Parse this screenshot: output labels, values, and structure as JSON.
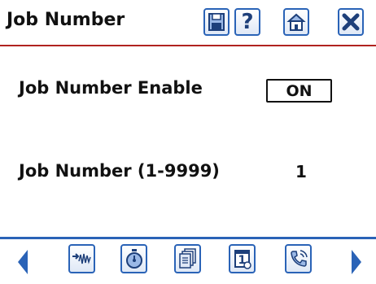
{
  "header": {
    "title": "Job Number",
    "buttons": [
      {
        "icon": "save-icon"
      },
      {
        "icon": "help-icon",
        "glyph": "?"
      },
      {
        "icon": "home-icon"
      },
      {
        "icon": "close-icon"
      }
    ]
  },
  "settings": {
    "enable_label": "Job Number Enable",
    "enable_value": "ON",
    "number_label": "Job Number (1-9999)",
    "number_value": "1"
  },
  "footer": {
    "buttons": [
      {
        "icon": "signal-input-icon"
      },
      {
        "icon": "stopwatch-icon"
      },
      {
        "icon": "documents-icon"
      },
      {
        "icon": "calendar-icon",
        "glyph": "1"
      },
      {
        "icon": "phone-icon"
      }
    ]
  },
  "colors": {
    "accent": "#2a63b7",
    "divider": "#b0231f",
    "text": "#111111"
  }
}
